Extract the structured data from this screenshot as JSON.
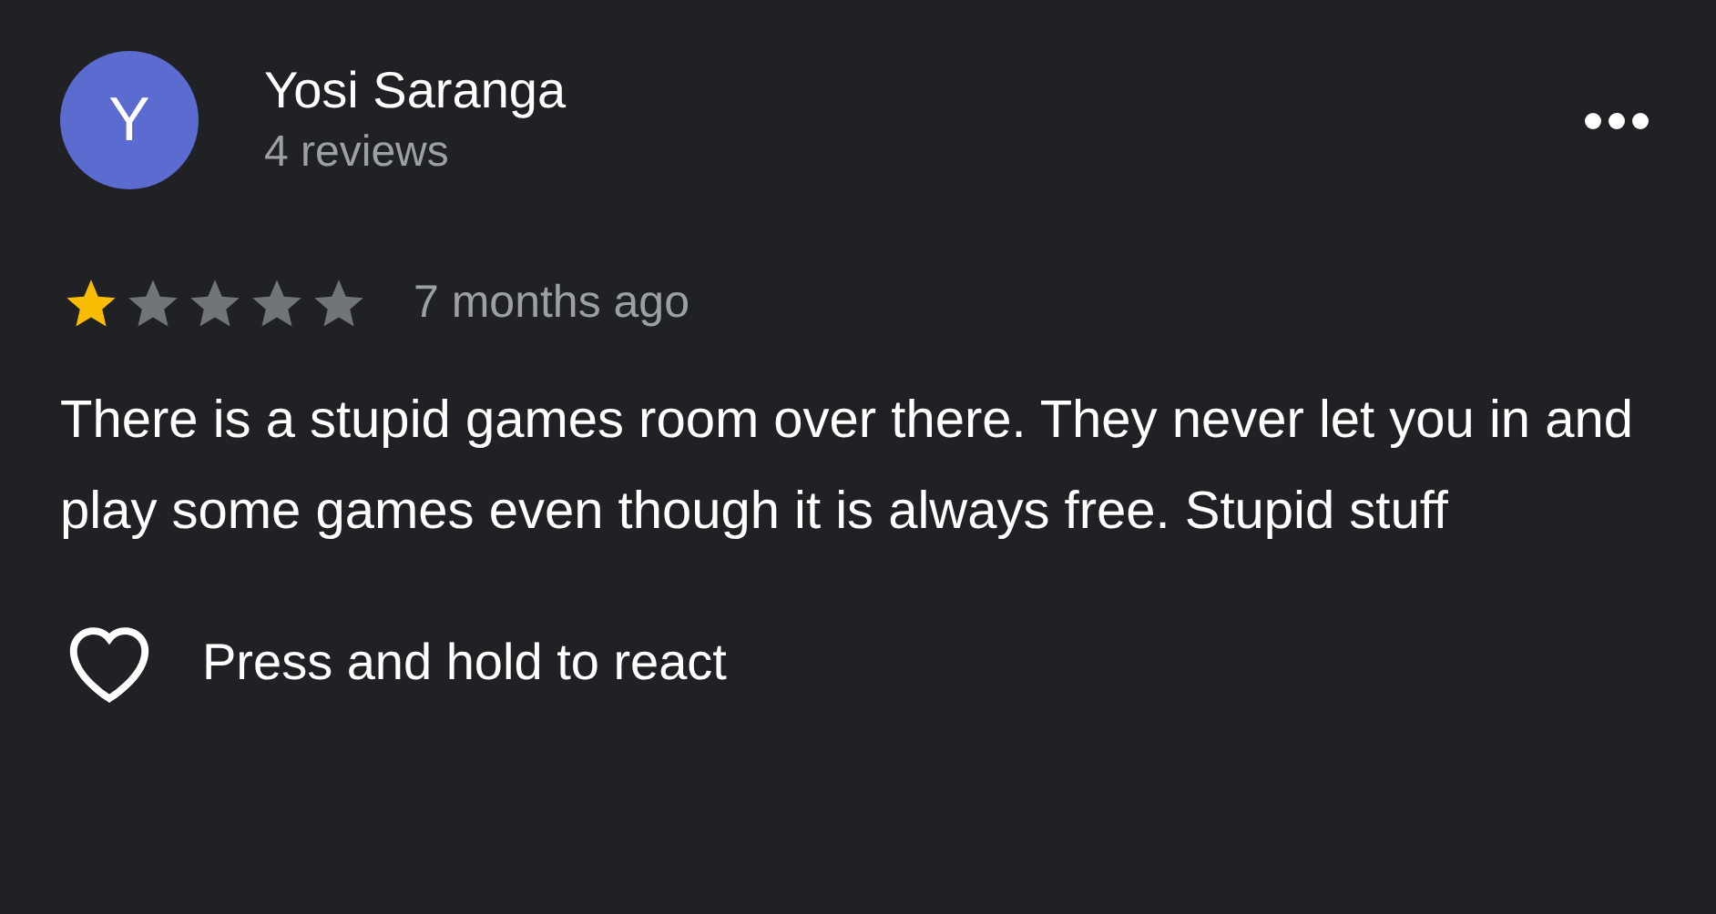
{
  "review": {
    "avatar_letter": "Y",
    "author": "Yosi Saranga",
    "reviews_count": "4 reviews",
    "stars": 1,
    "time": "7 months ago",
    "text": "There is a stupid games room over there. They never let you in and play some games even though it is always free. Stupid stuff",
    "reaction_label": "Press and hold to react"
  }
}
